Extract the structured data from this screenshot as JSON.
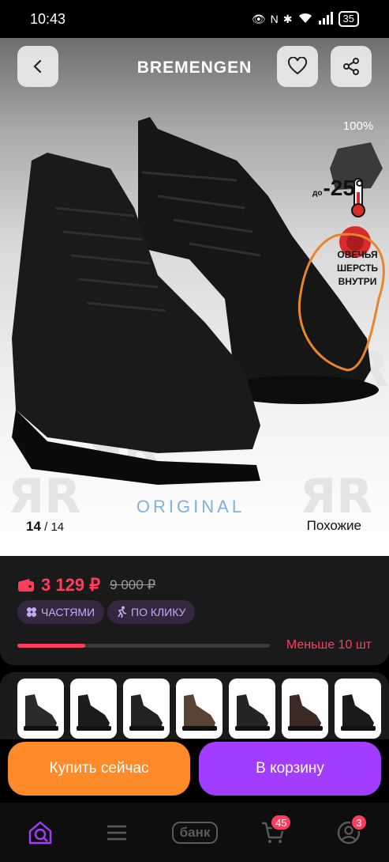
{
  "status_bar": {
    "time": "10:43",
    "battery": "35"
  },
  "product": {
    "brand": "BREMENGEN",
    "watermark": "ORIGINAL",
    "badges": {
      "percent": "100%",
      "temp_prefix": "до",
      "temp": "-25°",
      "wool": "ОВЕЧЬЯ ШЕРСТЬ ВНУТРИ"
    },
    "image_index": "14",
    "image_total": "14",
    "similar_label": "Похожие"
  },
  "price": {
    "current": "3 129 ₽",
    "old": "9 000 ₽"
  },
  "tags": {
    "installments": "ЧАСТЯМИ",
    "one_click": "ПО КЛИКУ"
  },
  "stock": {
    "label": "Меньше 10 шт",
    "level": 0.27
  },
  "actions": {
    "buy_now": "Купить сейчас",
    "add_to_cart": "В корзину"
  },
  "thumbnails": [
    {
      "name": "boot-variant-1",
      "color": "#2b2b2b"
    },
    {
      "name": "boot-variant-2",
      "color": "#1c1c1c"
    },
    {
      "name": "boot-variant-3",
      "color": "#222222"
    },
    {
      "name": "boot-variant-4",
      "color": "#5a4334"
    },
    {
      "name": "boot-variant-5",
      "color": "#252525"
    },
    {
      "name": "boot-variant-6",
      "color": "#3b2a24"
    },
    {
      "name": "boot-variant-7",
      "color": "#1a1a1a"
    }
  ],
  "nav": {
    "bank_label": "банк",
    "cart_badge": "45",
    "profile_badge": "3"
  },
  "colors": {
    "accent_red": "#ff3d5b",
    "orange": "#ff8a2a",
    "purple": "#a23dff"
  }
}
